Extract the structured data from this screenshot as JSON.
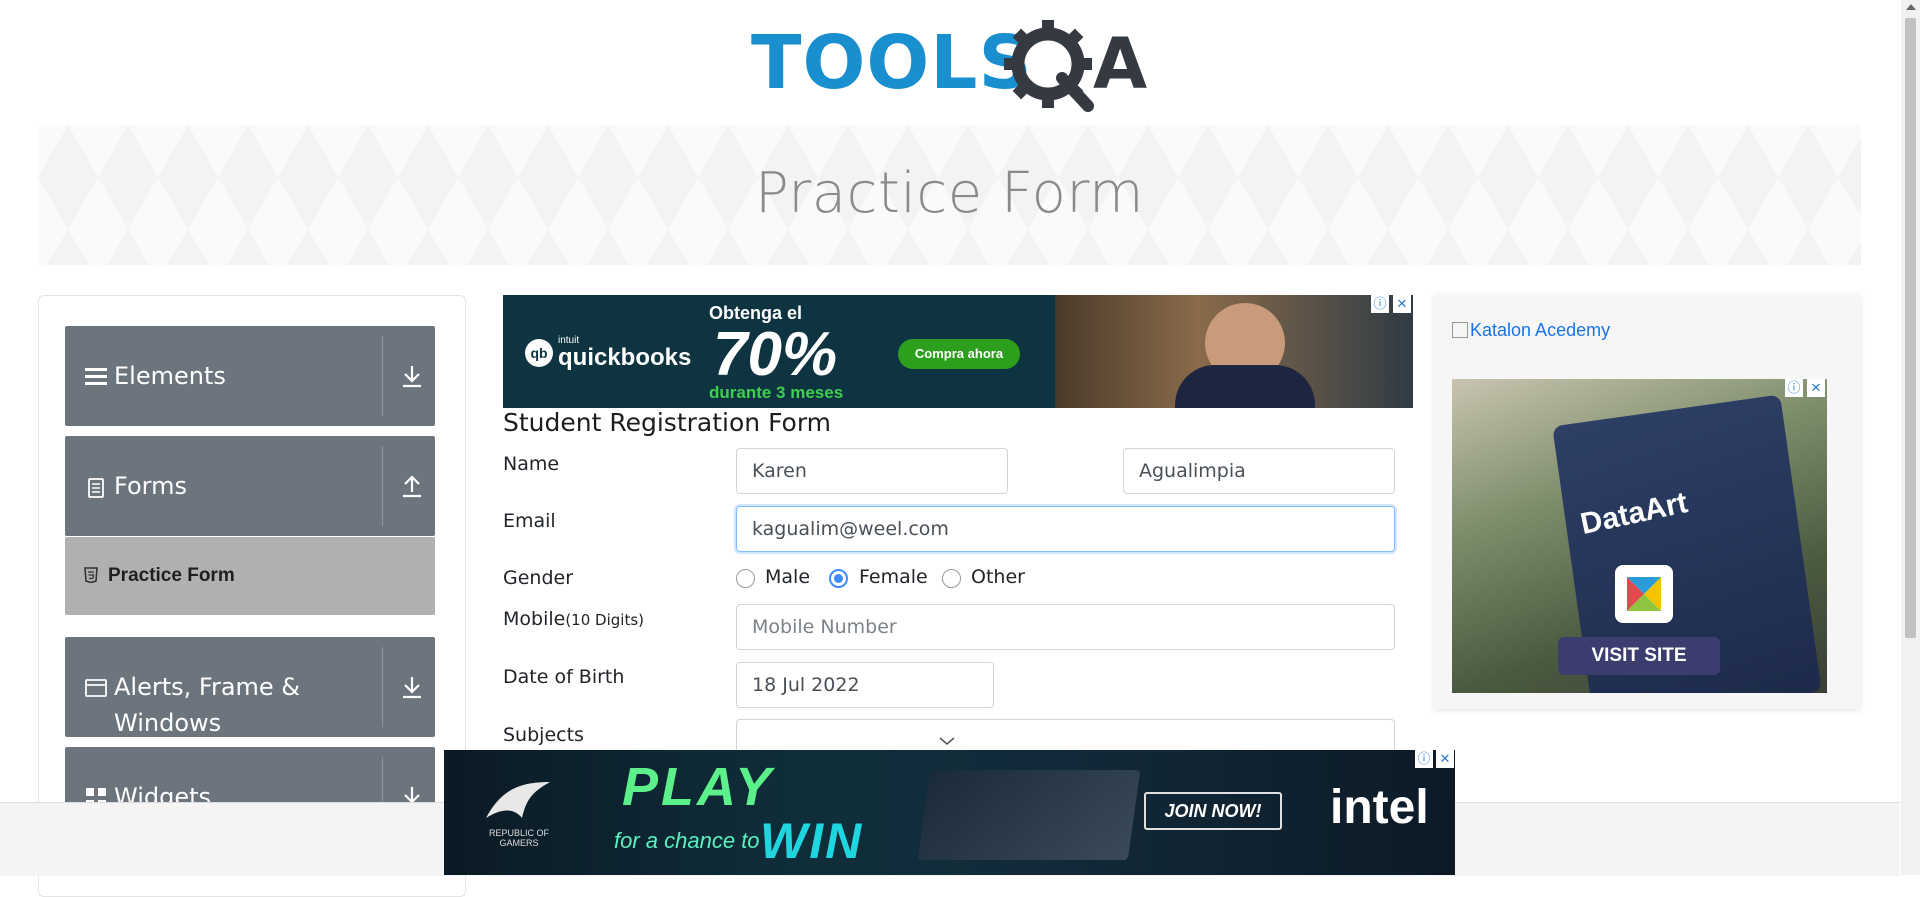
{
  "brand": {
    "logo_text": "TOOLSQA"
  },
  "banner": {
    "title": "Practice Form"
  },
  "sidebar": {
    "groups": [
      {
        "label": "Elements",
        "state": "collapsed"
      },
      {
        "label": "Forms",
        "state": "expanded",
        "items": [
          {
            "label": "Practice Form",
            "active": true
          }
        ]
      },
      {
        "label": "Alerts, Frame &",
        "label_line2": "Windows",
        "state": "collapsed"
      },
      {
        "label": "Widgets",
        "state": "collapsed"
      }
    ]
  },
  "form": {
    "title": "Student Registration Form",
    "name": {
      "label": "Name",
      "first_value": "Karen",
      "last_value": "Agualimpia"
    },
    "email": {
      "label": "Email",
      "value": "kagualim@weel.com"
    },
    "gender": {
      "label": "Gender",
      "options": [
        "Male",
        "Female",
        "Other"
      ],
      "selected": "Female"
    },
    "mobile": {
      "label": "Mobile",
      "hint": "(10 Digits)",
      "placeholder": "Mobile Number"
    },
    "dob": {
      "label": "Date of Birth",
      "value": "18 Jul 2022"
    },
    "subjects": {
      "label": "Subjects",
      "value": ""
    }
  },
  "ads": {
    "top": {
      "brand": "quickbooks",
      "brand_prefix": "intuit",
      "headline": "Obtenga el",
      "big": "70%",
      "sub": "durante 3 meses",
      "cta": "Compra ahora"
    },
    "right": {
      "link_text": "Katalon Acedemy",
      "brand": "DataArt",
      "cta": "VISIT SITE"
    },
    "bottom": {
      "brand_line1": "REPUBLIC OF",
      "brand_line2": "GAMERS",
      "play": "PLAY",
      "for_chance": "for a chance to",
      "win": "WIN",
      "cta": "JOIN NOW!",
      "sponsor": "intel"
    }
  },
  "colors": {
    "sidebar_header": "#6c757d",
    "active_item": "#b0b0b0",
    "focus_border": "#80bdff",
    "radio_checked": "#3d8bfd",
    "logo_blue": "#1a8fd0",
    "logo_dark": "#343a40"
  }
}
